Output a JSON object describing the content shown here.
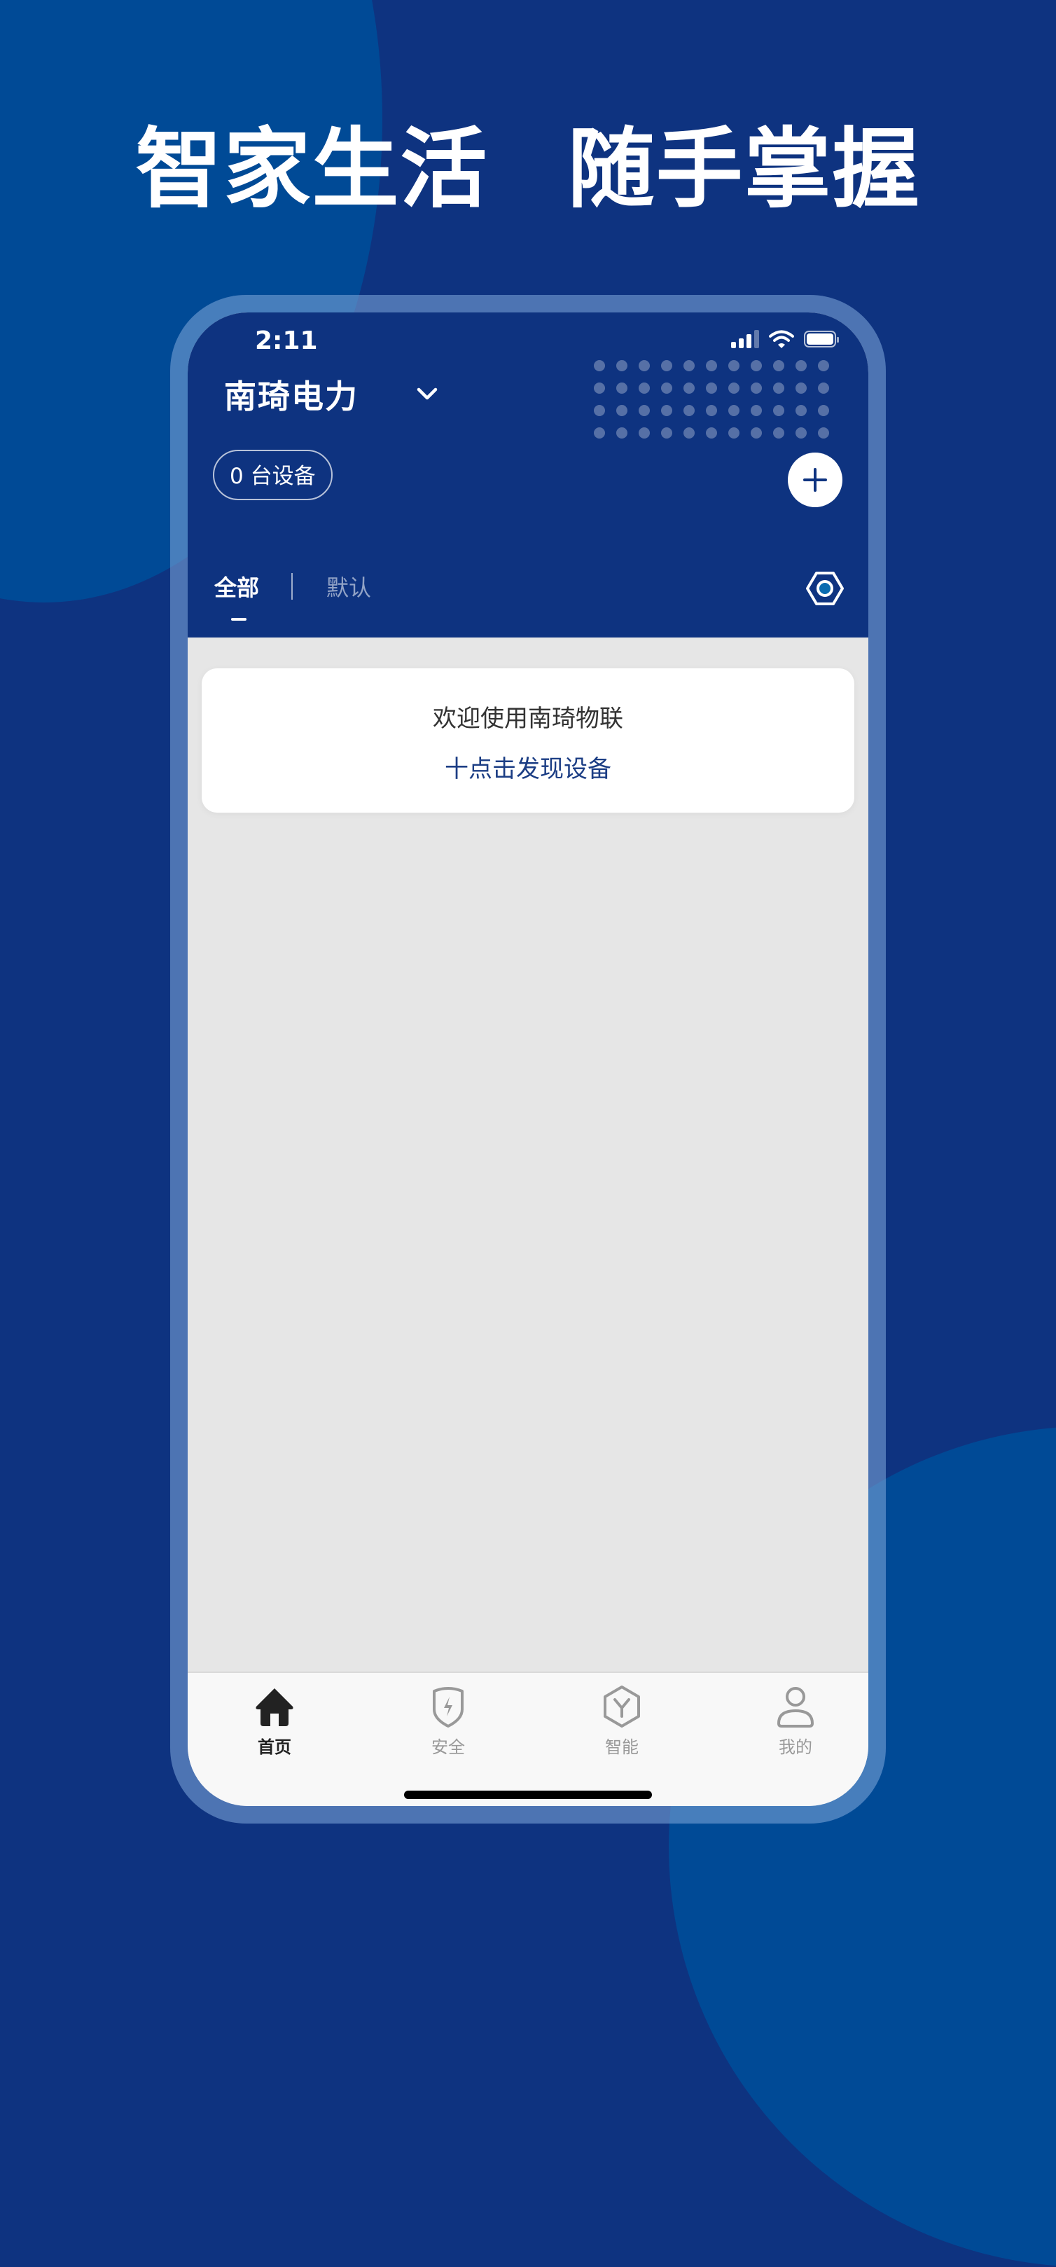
{
  "promo": {
    "headline_left": "智家生活",
    "headline_right": "随手掌握"
  },
  "status_bar": {
    "time": "2:11",
    "signal_icon": "cellular-signal-icon",
    "wifi_icon": "wifi-icon",
    "battery_icon": "battery-icon"
  },
  "header": {
    "title": "南琦电力",
    "title_dropdown_icon": "chevron-down-icon",
    "device_count_label": "0 台设备",
    "add_icon": "plus-icon"
  },
  "tabs": {
    "items": [
      {
        "label": "全部",
        "active": true
      },
      {
        "label": "默认",
        "active": false
      }
    ],
    "settings_icon": "hexagon-settings-icon"
  },
  "welcome_card": {
    "title": "欢迎使用南琦物联",
    "action_label": "十点击发现设备"
  },
  "bottom_nav": {
    "items": [
      {
        "label": "首页",
        "icon": "home-icon",
        "active": true
      },
      {
        "label": "安全",
        "icon": "shield-bolt-icon",
        "active": false
      },
      {
        "label": "智能",
        "icon": "hexagon-y-icon",
        "active": false
      },
      {
        "label": "我的",
        "icon": "user-icon",
        "active": false
      }
    ]
  },
  "colors": {
    "brand_navy": "#0e3380",
    "background_accent": "#004a96",
    "link_blue": "#1b3d84",
    "content_bg": "#e6e6e6",
    "nav_active": "#222222",
    "nav_inactive": "#999999"
  }
}
